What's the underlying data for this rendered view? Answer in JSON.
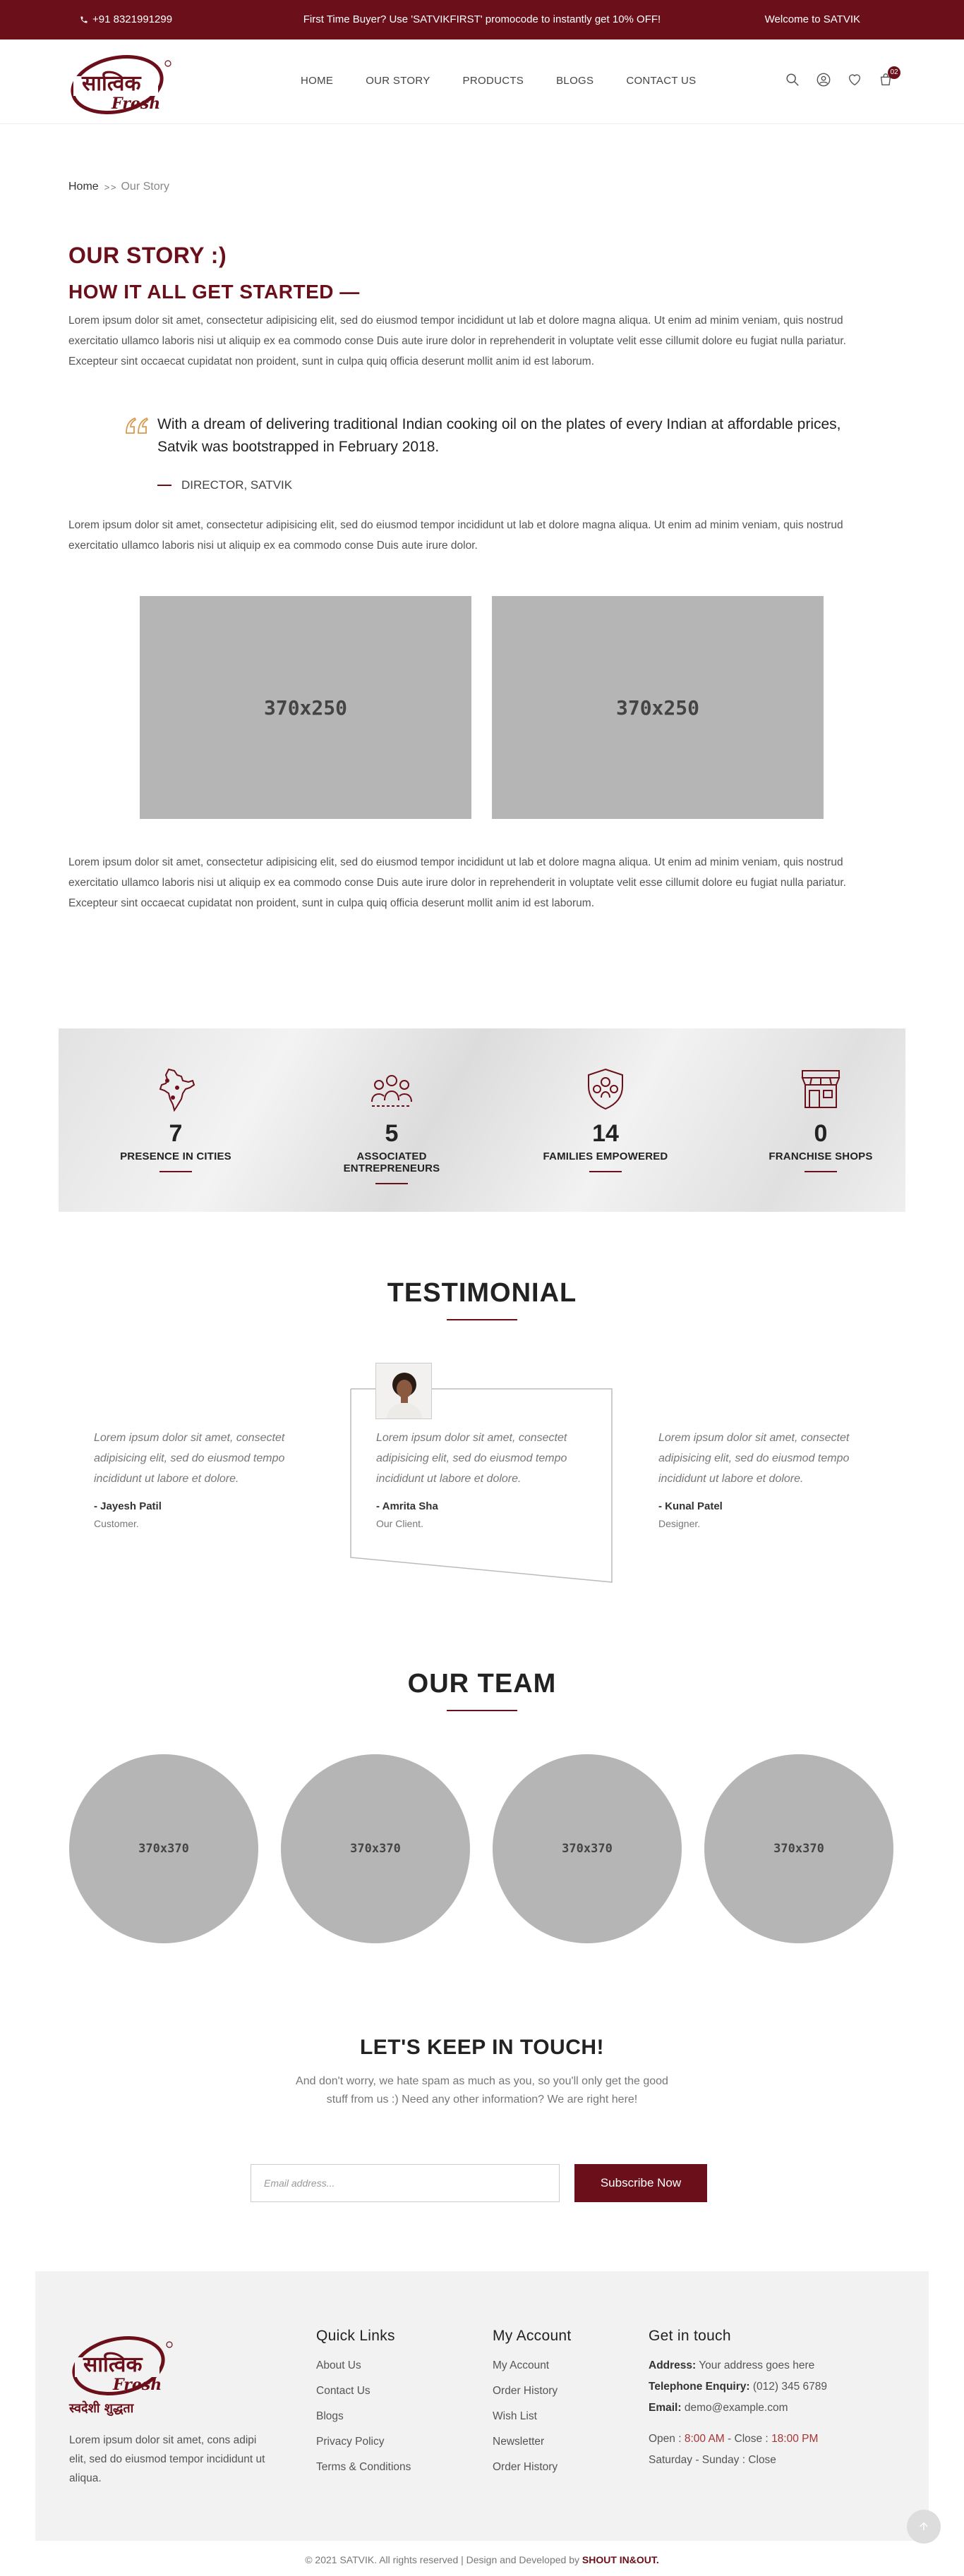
{
  "topbar": {
    "phone": "+91 8321991299",
    "promo": "First Time Buyer? Use 'SATVIKFIRST' promocode to instantly get 10% OFF!",
    "welcome": "Welcome to SATVIK"
  },
  "header": {
    "logo_main": "सात्विक",
    "logo_sub": "Fresh",
    "nav": [
      "HOME",
      "OUR STORY",
      "PRODUCTS",
      "BLOGS",
      "CONTACT US"
    ],
    "cart_count": "02"
  },
  "breadcrumb": {
    "home": "Home",
    "separator": "> >",
    "current": "Our Story"
  },
  "story": {
    "title": "OUR STORY :)",
    "subtitle": "HOW IT ALL GET STARTED —",
    "para1": "Lorem ipsum dolor sit amet, consectetur adipisicing elit, sed do eiusmod tempor incididunt ut lab et dolore magna aliqua. Ut enim ad minim veniam, quis nostrud exercitatio ullamco laboris nisi ut aliquip ex ea commodo conse Duis aute irure dolor in reprehenderit in voluptate velit esse cillumit dolore eu fugiat nulla pariatur. Excepteur sint occaecat cupidatat non proident, sunt in culpa quiq officia deserunt mollit anim id est laborum.",
    "quote": "With a dream of delivering traditional Indian cooking oil on the plates of every Indian at affordable prices, Satvik was bootstrapped in February 2018.",
    "quote_author": "DIRECTOR, SATVIK",
    "para2": "Lorem ipsum dolor sit amet, consectetur adipisicing elit, sed do eiusmod tempor incididunt ut lab et dolore magna aliqua. Ut enim ad minim veniam, quis nostrud exercitatio ullamco laboris nisi ut aliquip ex ea commodo conse Duis aute irure dolor.",
    "image1": "370x250",
    "image2": "370x250",
    "para3": "Lorem ipsum dolor sit amet, consectetur adipisicing elit, sed do eiusmod tempor incididunt ut lab et dolore magna aliqua. Ut enim ad minim veniam, quis nostrud exercitatio ullamco laboris nisi ut aliquip ex ea commodo conse Duis aute irure dolor in reprehenderit in voluptate velit esse cillumit dolore eu fugiat nulla pariatur. Excepteur sint occaecat cupidatat non proident, sunt in culpa quiq officia deserunt mollit anim id est laborum."
  },
  "stats": [
    {
      "num": "7",
      "label": "PRESENCE IN CITIES",
      "icon": "india-map-icon"
    },
    {
      "num": "5",
      "label": "ASSOCIATED ENTREPRENEURS",
      "icon": "people-group-icon"
    },
    {
      "num": "14",
      "label": "FAMILIES EMPOWERED",
      "icon": "family-shield-icon"
    },
    {
      "num": "0",
      "label": "FRANCHISE SHOPS",
      "icon": "shop-icon"
    }
  ],
  "testimonial": {
    "title": "TESTIMONIAL",
    "items": [
      {
        "text": "Lorem ipsum dolor sit amet, consectet adipisicing elit, sed do eiusmod tempo incididunt ut labore et dolore.",
        "name": "- Jayesh Patil",
        "role": "Customer."
      },
      {
        "text": "Lorem ipsum dolor sit amet, consectet adipisicing elit, sed do eiusmod tempo incididunt ut labore et dolore.",
        "name": "- Amrita Sha",
        "role": "Our Client."
      },
      {
        "text": "Lorem ipsum dolor sit amet, consectet adipisicing elit, sed do eiusmod tempo incididunt ut labore et dolore.",
        "name": "- Kunal Patel",
        "role": "Designer."
      }
    ]
  },
  "team": {
    "title": "OUR TEAM",
    "members": [
      "370x370",
      "370x370",
      "370x370",
      "370x370"
    ]
  },
  "newsletter": {
    "title": "LET'S KEEP IN TOUCH!",
    "desc": "And don't worry, we hate spam as much as you, so you'll only get the good stuff from us :) Need any other information? We are right here!",
    "placeholder": "Email address...",
    "button": "Subscribe Now"
  },
  "footer": {
    "tagline": "स्वदेशी शुद्धता",
    "desc": "Lorem ipsum dolor sit amet, cons adipi elit, sed do eiusmod tempor incididunt ut aliqua.",
    "quick_links": {
      "title": "Quick Links",
      "items": [
        "About Us",
        "Contact Us",
        "Blogs",
        "Privacy Policy",
        "Terms & Conditions"
      ]
    },
    "my_account": {
      "title": "My Account",
      "items": [
        "My Account",
        "Order History",
        "Wish List",
        "Newsletter",
        "Order History"
      ]
    },
    "contact": {
      "title": "Get in touch",
      "address_label": "Address:",
      "address": "Your address goes here",
      "phone_label": "Telephone Enquiry:",
      "phone": "(012) 345 6789",
      "email_label": "Email:",
      "email": "demo@example.com",
      "hours_open": "Open :",
      "hours_open_time": "8:00 AM",
      "hours_close": "- Close :",
      "hours_close_time": "18:00 PM",
      "weekend": "Saturday - Sunday : Close"
    },
    "copyright": "© 2021 SATVIK. All rights reserved | Design and Developed by",
    "developer": "SHOUT IN&OUT."
  },
  "colors": {
    "brand": "#6b0f1a",
    "placeholder": "#b5b5b5"
  }
}
